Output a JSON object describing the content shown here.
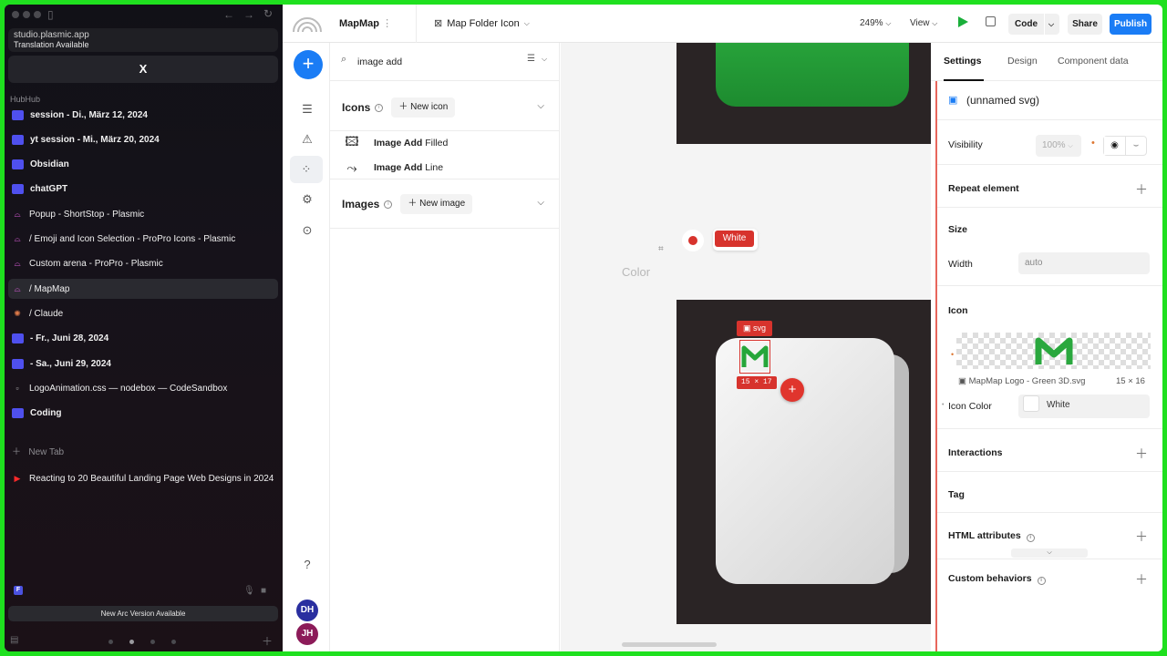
{
  "arc": {
    "url": "studio.plasmic.app",
    "translation": "Translation Available",
    "pinned_x": "X",
    "space_name": "HubHub",
    "tabs": [
      {
        "kind": "folder",
        "label": "session - Di., März 12, 2024"
      },
      {
        "kind": "folder",
        "label": "yt session - Mi., März 20, 2024"
      },
      {
        "kind": "folder",
        "label": "Obsidian"
      },
      {
        "kind": "folder",
        "label": "chatGPT"
      },
      {
        "kind": "plasmic",
        "label": "Popup - ShortStop - Plasmic"
      },
      {
        "kind": "plasmic",
        "label": "/ Emoji and Icon Selection - ProPro Icons - Plasmic"
      },
      {
        "kind": "plasmic",
        "label": "Custom arena - ProPro - Plasmic"
      },
      {
        "kind": "plasmic",
        "label": "/ MapMap",
        "selected": true
      },
      {
        "kind": "claude",
        "label": "/ Claude"
      },
      {
        "kind": "folder",
        "label": "- Fr., Juni 28, 2024"
      },
      {
        "kind": "folder",
        "label": "- Sa., Juni 29, 2024"
      },
      {
        "kind": "code",
        "label": "LogoAnimation.css — nodebox — CodeSandbox"
      },
      {
        "kind": "folder",
        "label": "Coding"
      }
    ],
    "new_tab": "New Tab",
    "youtube_tab": "Reacting to 20 Beautiful Landing Page Web Designs in 2024",
    "fbadge": "F",
    "update": "New Arc Version Available"
  },
  "topbar": {
    "project": "MapMap",
    "component": "Map Folder Icon",
    "zoom": "249%",
    "view": "View",
    "code": "Code",
    "share": "Share",
    "publish": "Publish"
  },
  "rail": {
    "avatars": [
      {
        "initials": "DH",
        "color": "#2a2fa0"
      },
      {
        "initials": "JH",
        "color": "#8c1b59"
      }
    ]
  },
  "insert": {
    "search_value": "image add",
    "icons_title": "Icons",
    "new_icon": "New icon",
    "icon_items": [
      {
        "name": "Image Add",
        "variant": "Filled"
      },
      {
        "name": "Image Add",
        "variant": "Line"
      }
    ],
    "images_title": "Images",
    "new_image": "New image"
  },
  "canvas": {
    "chip_label": "White",
    "color_label": "Color",
    "svg_tag": "svg",
    "dimensions": "15 × 17"
  },
  "right": {
    "tabs": [
      "Settings",
      "Design",
      "Component data"
    ],
    "element_name": "(unnamed svg)",
    "visibility_label": "Visibility",
    "visibility_value": "100%",
    "repeat": "Repeat element",
    "size": "Size",
    "width_label": "Width",
    "width_value": "auto",
    "icon_label": "Icon",
    "icon_file": "MapMap Logo - Green 3D.svg",
    "icon_dims": "15 × 16",
    "icon_color_label": "Icon Color",
    "icon_color_value": "White",
    "interactions": "Interactions",
    "tag": "Tag",
    "html_attrs": "HTML attributes",
    "custom_behaviors": "Custom behaviors"
  },
  "colors": {
    "accent": "#1a7cf5",
    "selection": "#d7332d",
    "brand_green": "#1d8b2f",
    "frame": "#1fe01f"
  }
}
